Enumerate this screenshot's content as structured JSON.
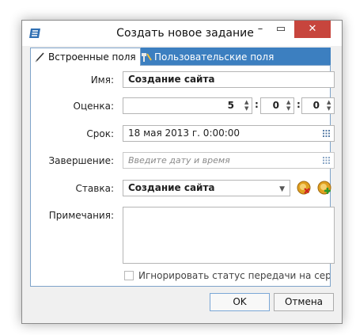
{
  "window": {
    "title": "Создать новое задание"
  },
  "titlebar": {
    "minimize": "–",
    "maximize": "▭",
    "close": "✕"
  },
  "tabs": [
    {
      "label": "Встроенные поля",
      "active": true,
      "icon": "pencil-icon"
    },
    {
      "label": "Пользовательские поля",
      "active": false,
      "icon": "tools-icon"
    }
  ],
  "form": {
    "name_label": "Имя:",
    "name_value": "Создание сайта",
    "estimate_label": "Оценка:",
    "estimate_hours": "5",
    "estimate_minutes": "0",
    "estimate_seconds": "0",
    "estimate_sep1": ":",
    "estimate_sep2": ":",
    "due_label": "Срок:",
    "due_value": "18 мая 2013 г. 0:00:00",
    "completion_label": "Завершение:",
    "completion_placeholder": "Введите дату и время",
    "rate_label": "Ставка:",
    "rate_value": "Создание сайта",
    "notes_label": "Примечания:",
    "notes_value": "",
    "ignore_checkbox_label": "Игнорировать статус передачи на сервер Tas",
    "ignore_checked": false
  },
  "buttons": {
    "ok": "OK",
    "cancel": "Отмена"
  },
  "colors": {
    "accent": "#3c7fc0",
    "close": "#c7453d"
  }
}
